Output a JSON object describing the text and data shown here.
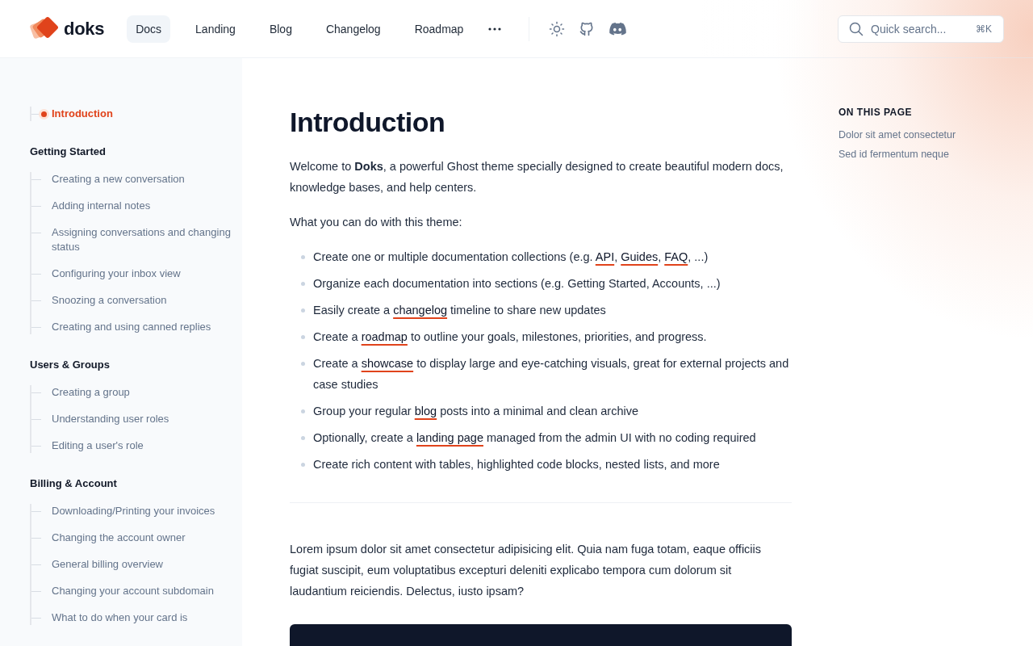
{
  "brand": {
    "name": "doks"
  },
  "nav": [
    {
      "label": "Docs",
      "selected": true
    },
    {
      "label": "Landing",
      "selected": false
    },
    {
      "label": "Blog",
      "selected": false
    },
    {
      "label": "Changelog",
      "selected": false
    },
    {
      "label": "Roadmap",
      "selected": false
    }
  ],
  "search": {
    "placeholder": "Quick search...",
    "shortcut": "⌘K"
  },
  "sidebar": [
    {
      "kind": "link",
      "label": "Introduction",
      "selected": true
    },
    {
      "kind": "section",
      "title": "Getting Started",
      "children": [
        {
          "label": "Creating a new conversation",
          "selected": false
        },
        {
          "label": "Adding internal notes",
          "selected": false
        },
        {
          "label": "Assigning conversations and changing status",
          "selected": false
        },
        {
          "label": "Configuring your inbox view",
          "selected": false
        },
        {
          "label": "Snoozing a conversation",
          "selected": false
        },
        {
          "label": "Creating and using canned replies",
          "selected": false
        }
      ]
    },
    {
      "kind": "section",
      "title": "Users & Groups",
      "children": [
        {
          "label": "Creating a group",
          "selected": false
        },
        {
          "label": "Understanding user roles",
          "selected": false
        },
        {
          "label": "Editing a user's role",
          "selected": false
        }
      ]
    },
    {
      "kind": "section",
      "title": "Billing & Account",
      "children": [
        {
          "label": "Downloading/Printing your invoices",
          "selected": false
        },
        {
          "label": "Changing the account owner",
          "selected": false
        },
        {
          "label": "General billing overview",
          "selected": false
        },
        {
          "label": "Changing your account subdomain",
          "selected": false
        },
        {
          "label": "What to do when your card is",
          "selected": false
        }
      ]
    }
  ],
  "article": {
    "title": "Introduction",
    "intro": "Welcome to **Doks**, a powerful Ghost theme specially designed to create beautiful modern docs, knowledge bases, and help centers.",
    "lead": "What you can do with this theme:",
    "features": [
      {
        "parts": [
          {
            "kind": "text",
            "text": "Create one or multiple documentation collections (e.g. "
          },
          {
            "kind": "link",
            "text": "API"
          },
          {
            "kind": "text",
            "text": ", "
          },
          {
            "kind": "link",
            "text": "Guides"
          },
          {
            "kind": "text",
            "text": ", "
          },
          {
            "kind": "link",
            "text": "FAQ"
          },
          {
            "kind": "text",
            "text": ", ...)"
          }
        ]
      },
      {
        "parts": [
          {
            "kind": "text",
            "text": "Organize each documentation into sections (e.g. Getting Started, Accounts, ...)"
          }
        ]
      },
      {
        "parts": [
          {
            "kind": "text",
            "text": "Easily create a "
          },
          {
            "kind": "link",
            "text": "changelog"
          },
          {
            "kind": "text",
            "text": " timeline to share new updates"
          }
        ]
      },
      {
        "parts": [
          {
            "kind": "text",
            "text": "Create a "
          },
          {
            "kind": "link",
            "text": "roadmap"
          },
          {
            "kind": "text",
            "text": " to outline your goals, milestones, priorities, and progress."
          }
        ]
      },
      {
        "parts": [
          {
            "kind": "text",
            "text": "Create a "
          },
          {
            "kind": "link",
            "text": "showcase"
          },
          {
            "kind": "text",
            "text": " to display large and eye-catching visuals, great for external projects and case studies"
          }
        ]
      },
      {
        "parts": [
          {
            "kind": "text",
            "text": "Group your regular "
          },
          {
            "kind": "link",
            "text": "blog"
          },
          {
            "kind": "text",
            "text": " posts into a minimal and clean archive"
          }
        ]
      },
      {
        "parts": [
          {
            "kind": "text",
            "text": "Optionally, create a "
          },
          {
            "kind": "link",
            "text": "landing page"
          },
          {
            "kind": "text",
            "text": " managed from the admin UI with no coding required"
          }
        ]
      },
      {
        "parts": [
          {
            "kind": "text",
            "text": "Create rich content with tables, highlighted code blocks, nested lists, and more"
          }
        ]
      }
    ],
    "body": "Lorem ipsum dolor sit amet consectetur adipisicing elit. Quia nam fuga totam, eaque officiis fugiat suscipit, eum voluptatibus excepturi deleniti explicabo tempora cum dolorum sit laudantium reiciendis. Delectus, iusto ipsam?"
  },
  "toc": {
    "title": "ON THIS PAGE",
    "items": [
      "Dolor sit amet consectetur",
      "Sed id fermentum neque"
    ]
  }
}
